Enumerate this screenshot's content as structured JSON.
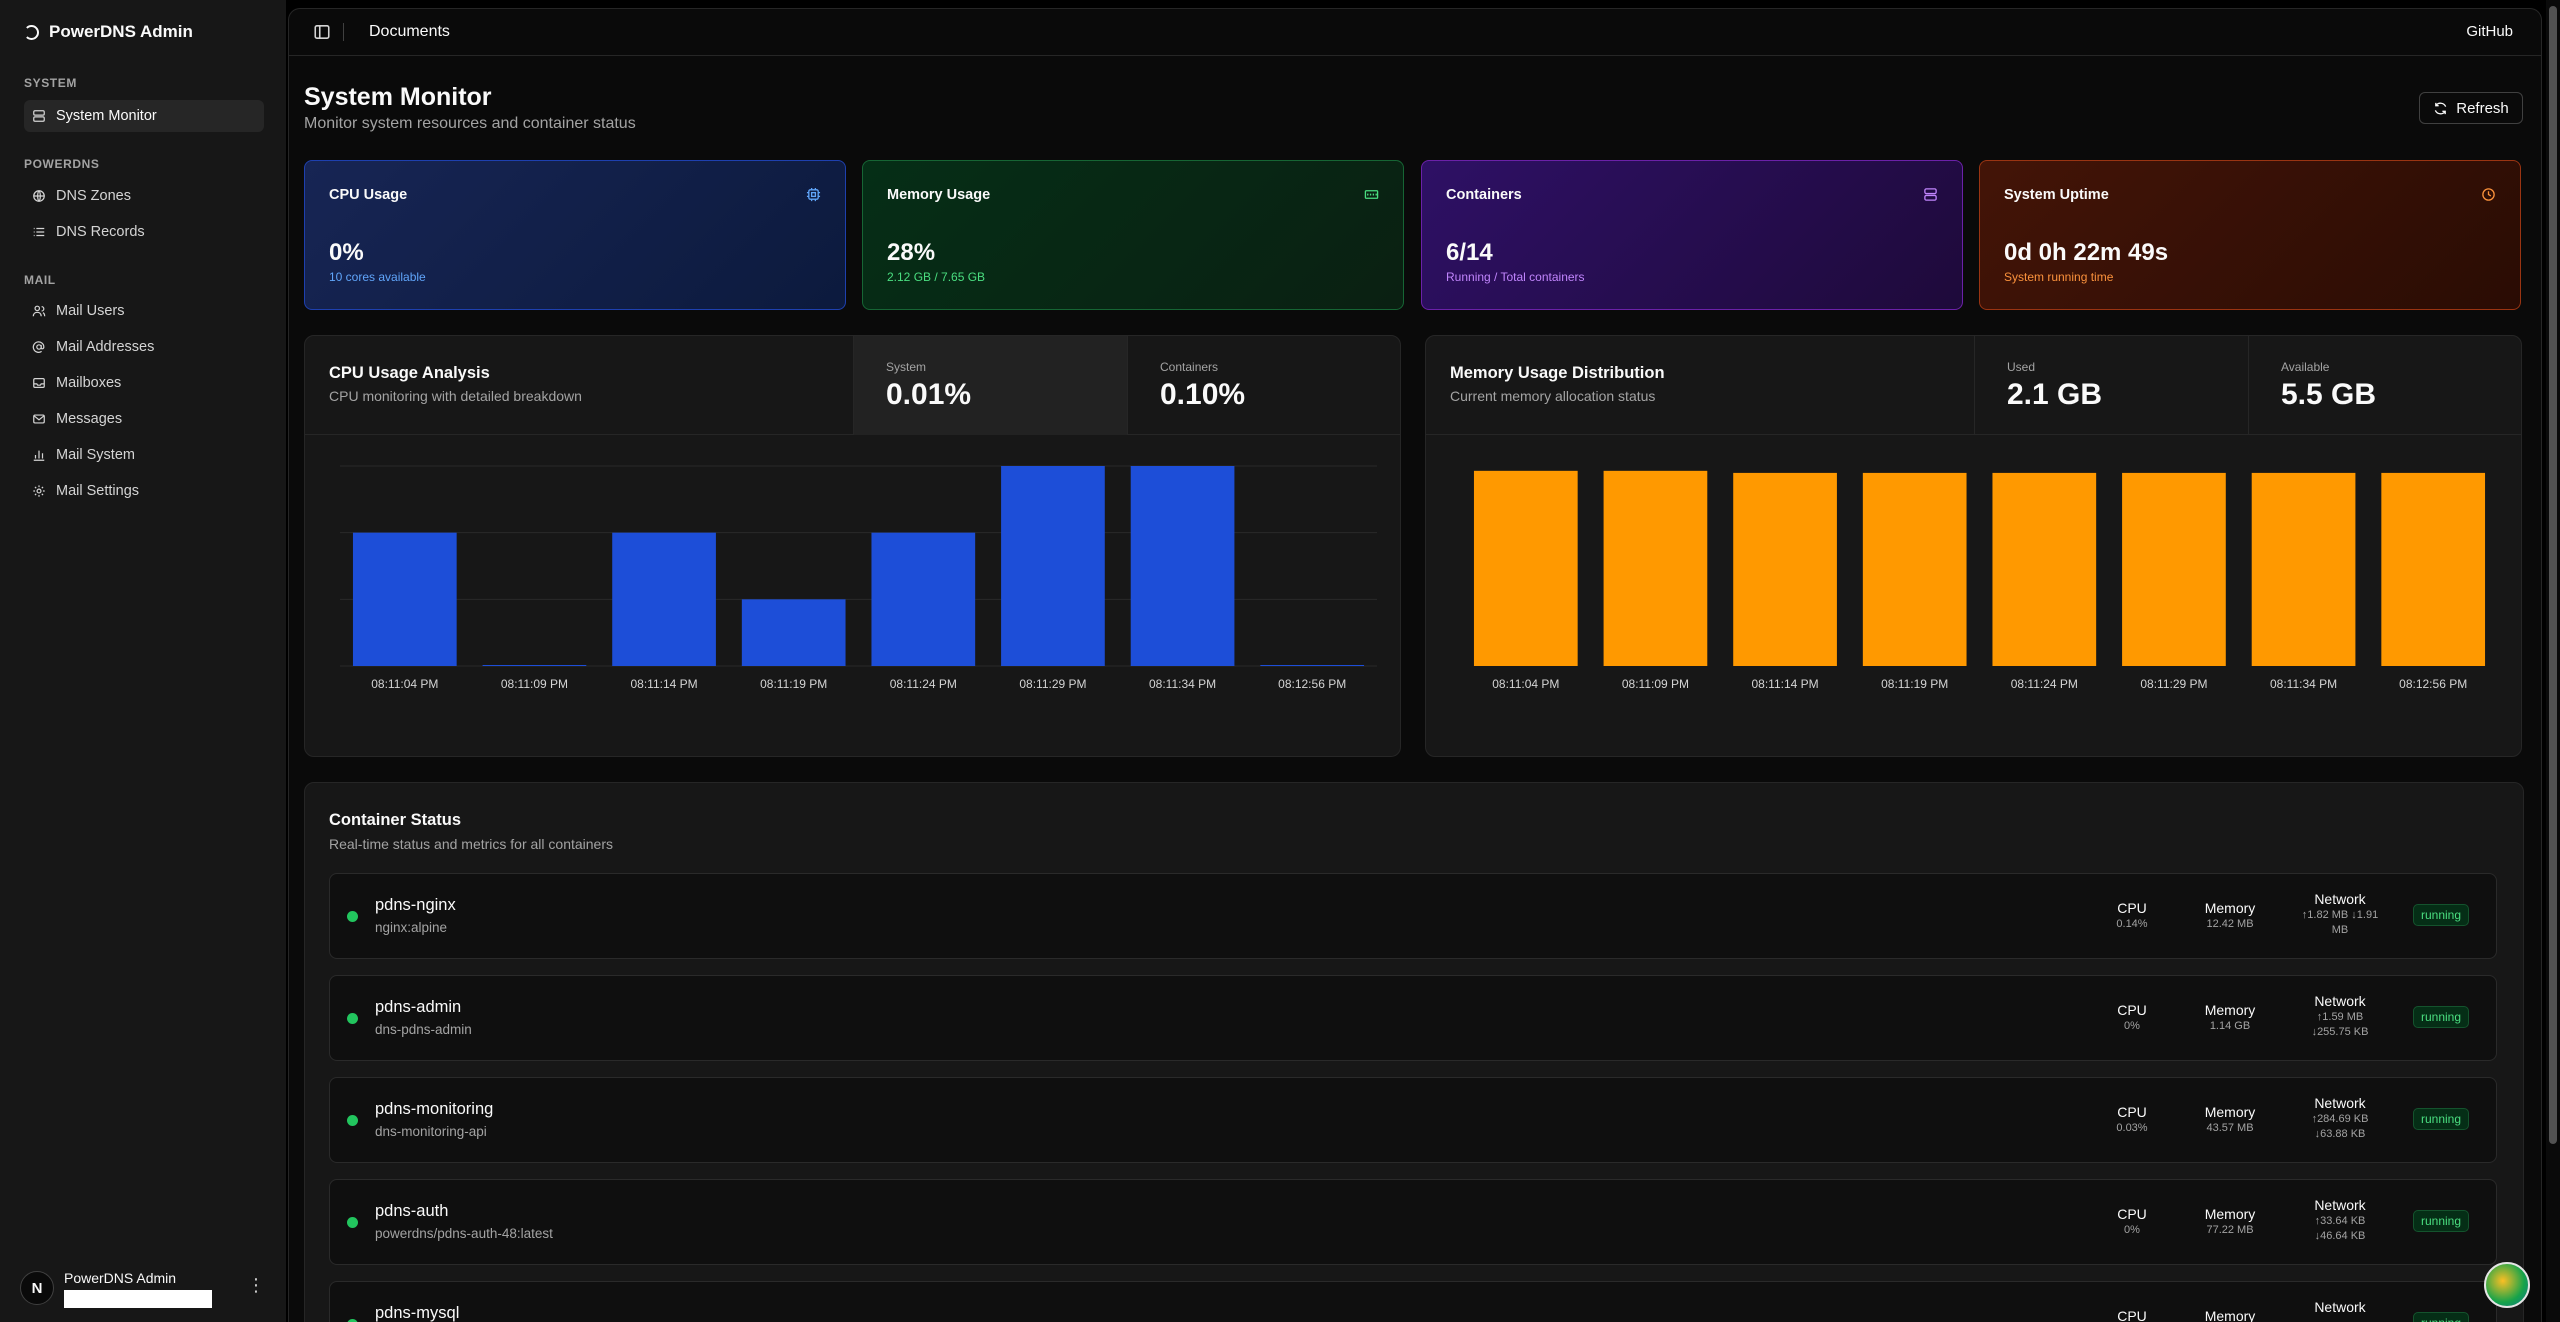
{
  "sidebar": {
    "brand": "PowerDNS Admin",
    "groups": [
      {
        "label": "SYSTEM",
        "items": [
          {
            "label": "System Monitor",
            "icon": "server-icon",
            "active": true
          }
        ]
      },
      {
        "label": "POWERDNS",
        "items": [
          {
            "label": "DNS Zones",
            "icon": "globe-icon"
          },
          {
            "label": "DNS Records",
            "icon": "list-icon"
          }
        ]
      },
      {
        "label": "MAIL",
        "items": [
          {
            "label": "Mail Users",
            "icon": "users-icon"
          },
          {
            "label": "Mail Addresses",
            "icon": "at-sign-icon"
          },
          {
            "label": "Mailboxes",
            "icon": "inbox-icon"
          },
          {
            "label": "Messages",
            "icon": "mail-icon"
          },
          {
            "label": "Mail System",
            "icon": "bar-chart-icon"
          },
          {
            "label": "Mail Settings",
            "icon": "gear-icon"
          }
        ]
      }
    ],
    "user": {
      "initial": "N",
      "name": "PowerDNS Admin"
    }
  },
  "topbar": {
    "breadcrumb": "Documents",
    "github": "GitHub"
  },
  "header": {
    "title": "System Monitor",
    "subtitle": "Monitor system resources and container status",
    "refresh_label": "Refresh"
  },
  "stats": {
    "cpu": {
      "title": "CPU Usage",
      "value": "0%",
      "note": "10 cores available",
      "icon": "cpu-icon"
    },
    "memory": {
      "title": "Memory Usage",
      "value": "28%",
      "note": "2.12 GB / 7.65 GB",
      "icon": "memory-icon"
    },
    "containers": {
      "title": "Containers",
      "value": "6/14",
      "note": "Running / Total containers",
      "icon": "server-icon"
    },
    "uptime": {
      "title": "System Uptime",
      "value": "0d 0h 22m 49s",
      "note": "System running time",
      "icon": "clock-icon"
    }
  },
  "cpu_panel": {
    "title": "CPU Usage Analysis",
    "subtitle": "CPU monitoring with detailed breakdown",
    "metrics": [
      {
        "label": "System",
        "value": "0.01%"
      },
      {
        "label": "Containers",
        "value": "0.10%"
      }
    ]
  },
  "mem_panel": {
    "title": "Memory Usage Distribution",
    "subtitle": "Current memory allocation status",
    "metrics": [
      {
        "label": "Used",
        "value": "2.1 GB"
      },
      {
        "label": "Available",
        "value": "5.5 GB"
      }
    ]
  },
  "chart_data": [
    {
      "type": "bar",
      "categories": [
        "08:11:04 PM",
        "08:11:09 PM",
        "08:11:14 PM",
        "08:11:19 PM",
        "08:11:24 PM",
        "08:11:29 PM",
        "08:11:34 PM",
        "08:12:56 PM"
      ],
      "values": [
        2,
        0,
        2,
        1,
        2,
        3,
        3,
        0
      ],
      "ylim": [
        0,
        3
      ],
      "color": "#1d4ed8",
      "grid": true
    },
    {
      "type": "bar",
      "categories": [
        "08:11:04 PM",
        "08:11:09 PM",
        "08:11:14 PM",
        "08:11:19 PM",
        "08:11:24 PM",
        "08:11:29 PM",
        "08:11:34 PM",
        "08:12:56 PM"
      ],
      "values": [
        28.3,
        28.3,
        28.0,
        28.0,
        28.0,
        28.0,
        28.0,
        28.0
      ],
      "ylim": [
        0,
        29
      ],
      "color": "#ff9900",
      "grid": false
    }
  ],
  "containers_panel": {
    "title": "Container Status",
    "subtitle": "Real-time status and metrics for all containers",
    "cpu_label": "CPU",
    "memory_label": "Memory",
    "network_label": "Network",
    "rows": [
      {
        "name": "pdns-nginx",
        "image": "nginx:alpine",
        "cpu": "0.14%",
        "memory": "12.42 MB",
        "net_line1": "↑1.82 MB ↓1.91",
        "net_line2": "MB",
        "status": "running"
      },
      {
        "name": "pdns-admin",
        "image": "dns-pdns-admin",
        "cpu": "0%",
        "memory": "1.14 GB",
        "net_line1": "↑1.59 MB",
        "net_line2": "↓255.75 KB",
        "status": "running"
      },
      {
        "name": "pdns-monitoring",
        "image": "dns-monitoring-api",
        "cpu": "0.03%",
        "memory": "43.57 MB",
        "net_line1": "↑284.69 KB",
        "net_line2": "↓63.88 KB",
        "status": "running"
      },
      {
        "name": "pdns-auth",
        "image": "powerdns/pdns-auth-48:latest",
        "cpu": "0%",
        "memory": "77.22 MB",
        "net_line1": "↑33.64 KB",
        "net_line2": "↓46.64 KB",
        "status": "running"
      },
      {
        "name": "pdns-mysql",
        "image": "",
        "cpu": "",
        "memory": "",
        "net_line1": "",
        "net_line2": "",
        "status": "running"
      }
    ]
  }
}
